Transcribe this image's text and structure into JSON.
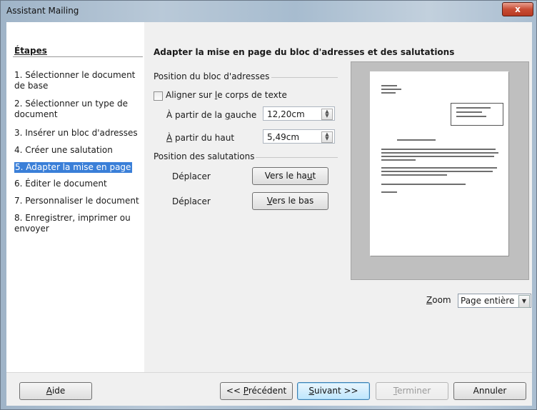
{
  "window": {
    "title": "Assistant Mailing",
    "close_glyph": "x"
  },
  "sidebar": {
    "title": "Étapes",
    "steps": [
      "1. Sélectionner le document de base",
      "2. Sélectionner un type de document",
      "3. Insérer un bloc d'adresses",
      "4. Créer une salutation",
      "5. Adapter la mise en page",
      "6. Éditer le document",
      "7. Personnaliser le document",
      "8. Enregistrer, imprimer ou envoyer"
    ],
    "active_index": 4
  },
  "main": {
    "heading": "Adapter la mise en page du bloc d'adresses et des salutations",
    "address_block": {
      "group_title": "Position du bloc d'adresses",
      "align_checkbox": {
        "pre": "Aligner sur ",
        "mnemonic": "l",
        "post": "e corps de texte",
        "checked": false
      },
      "from_left": {
        "label_pre": "À partir de la ",
        "label_mnemonic": "g",
        "label_post": "auche",
        "value": "12,20cm"
      },
      "from_top": {
        "label_mnemonic": "À",
        "label_post": " partir du haut",
        "value": "5,49cm"
      }
    },
    "salutation": {
      "group_title": "Position des salutations",
      "move_up": {
        "label": "Déplacer",
        "button_pre": "Vers le ha",
        "button_mnemonic": "u",
        "button_post": "t"
      },
      "move_down": {
        "label": "Déplacer",
        "button_mnemonic": "V",
        "button_post": "ers le bas"
      }
    },
    "zoom": {
      "label_mnemonic": "Z",
      "label_post": "oom",
      "value": "Page entière"
    }
  },
  "buttons": {
    "help": {
      "mnemonic": "A",
      "post": "ide"
    },
    "previous": {
      "pre": "<< ",
      "mnemonic": "P",
      "post": "récédent"
    },
    "next": {
      "mnemonic": "S",
      "post": "uivant >>"
    },
    "finish": {
      "mnemonic": "T",
      "post": "erminer"
    },
    "cancel": {
      "label": "Annuler"
    }
  },
  "colors": {
    "selection": "#3a7fd8",
    "dialog_bg": "#f0f0f0",
    "preview_bg": "#bfbfbf"
  }
}
